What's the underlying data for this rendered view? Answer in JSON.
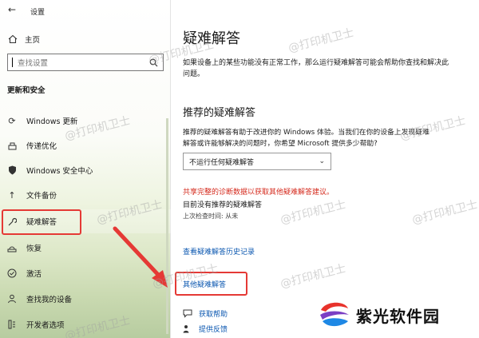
{
  "window": {
    "title": "设置"
  },
  "sidebar": {
    "home_label": "主页",
    "search_placeholder": "查找设置",
    "section_heading": "更新和安全",
    "items": [
      {
        "label": "Windows 更新",
        "icon": "sync-icon"
      },
      {
        "label": "传递优化",
        "icon": "delivery-icon"
      },
      {
        "label": "Windows 安全中心",
        "icon": "shield-icon"
      },
      {
        "label": "文件备份",
        "icon": "backup-arrow-icon"
      },
      {
        "label": "疑难解答",
        "icon": "wrench-icon",
        "selected": true
      },
      {
        "label": "恢复",
        "icon": "recovery-icon"
      },
      {
        "label": "激活",
        "icon": "activation-check-icon"
      },
      {
        "label": "查找我的设备",
        "icon": "person-location-icon"
      },
      {
        "label": "开发者选项",
        "icon": "developer-tools-icon"
      }
    ]
  },
  "main": {
    "title": "疑难解答",
    "description": "如果设备上的某些功能没有正常工作，那么运行疑难解答可能会帮助你查找和解决此问题。",
    "recommended_title": "推荐的疑难解答",
    "recommended_desc": "推荐的疑难解答有助于改进你的 Windows 体验。当我们在你的设备上发现疑难解答或许能够解决的问题时，你希望 Microsoft 提供多少帮助?",
    "dropdown_value": "不运行任何疑难解答",
    "diagnostic_link": "共享完整的诊断数据以获取其他疑难解答建议。",
    "no_recommended": "目前没有推荐的疑难解答",
    "last_checked": "上次检查时间: 从未",
    "history_link": "查看疑难解答历史记录",
    "other_link": "其他疑难解答",
    "get_help": "获取帮助",
    "feedback": "提供反馈"
  },
  "watermark": "@打印机卫士",
  "brand": {
    "name": "紫光软件园"
  },
  "colors": {
    "accent_red": "#e53935",
    "link_blue": "#0b57b0",
    "warning_red": "#d52b1e"
  }
}
